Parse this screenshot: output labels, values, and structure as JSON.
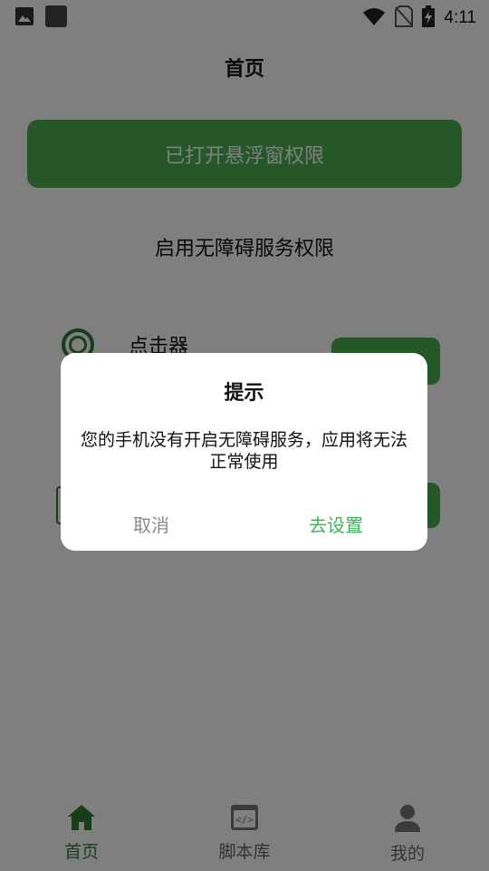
{
  "status_bar": {
    "time": "4:11",
    "icons": [
      "image-icon",
      "square-notification-icon",
      "wifi-icon",
      "no-sim-icon",
      "battery-charging-icon"
    ]
  },
  "header": {
    "title": "首页"
  },
  "main": {
    "overlay_button_label": "已打开悬浮窗权限",
    "accessibility_label": "启用无障碍服务权限",
    "clicker_label": "点击器"
  },
  "dialog": {
    "title": "提示",
    "message": "您的手机没有开启无障碍服务，应用将无法正常使用",
    "cancel_label": "取消",
    "confirm_label": "去设置"
  },
  "bottom_nav": {
    "items": [
      {
        "label": "首页",
        "icon": "home-icon",
        "active": true
      },
      {
        "label": "脚本库",
        "icon": "code-box-icon",
        "active": false
      },
      {
        "label": "我的",
        "icon": "person-icon",
        "active": false
      }
    ]
  },
  "colors": {
    "accent": "#4caf50",
    "accent_dark": "#2e7d32",
    "confirm_text": "#3cb45a",
    "cancel_text": "#8a8a8a",
    "overlay": "rgba(0,0,0,0.5)"
  }
}
